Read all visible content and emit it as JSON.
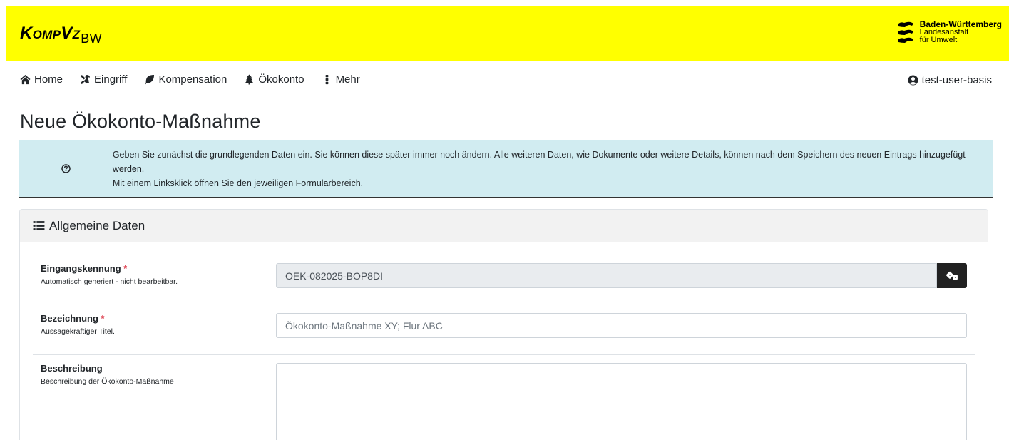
{
  "header": {
    "brand_main": "KOMPVZ",
    "brand_sub": "BW",
    "bw_line1": "Baden-Württemberg",
    "bw_line2": "Landesanstalt",
    "bw_line3": "für Umwelt"
  },
  "nav": {
    "items": [
      {
        "label": "Home",
        "icon": "home-icon"
      },
      {
        "label": "Eingriff",
        "icon": "tools-icon"
      },
      {
        "label": "Kompensation",
        "icon": "leaf-icon"
      },
      {
        "label": "Ökokonto",
        "icon": "tree-icon"
      },
      {
        "label": "Mehr",
        "icon": "vertical-dots-icon"
      }
    ],
    "user": "test-user-basis"
  },
  "page": {
    "title": "Neue Ökokonto-Maßnahme"
  },
  "info": {
    "line1": "Geben Sie zunächst die grundlegenden Daten ein. Sie können diese später immer noch ändern. Alle weiteren Daten, wie Dokumente oder weitere Details, können nach dem Speichern des neuen Eintrags hinzugefügt werden.",
    "line2": "Mit einem Linksklick öffnen Sie den jeweiligen Formularbereich."
  },
  "card": {
    "title": "Allgemeine Daten",
    "fields": {
      "identifier": {
        "label": "Eingangskennung",
        "required": "*",
        "help": "Automatisch generiert - nicht bearbeitbar.",
        "value": "OEK-082025-BOP8DI"
      },
      "title": {
        "label": "Bezeichnung",
        "required": "*",
        "help": "Aussagekräftiger Titel.",
        "placeholder": "Ökokonto-Maßnahme XY; Flur ABC"
      },
      "description": {
        "label": "Beschreibung",
        "help": "Beschreibung der Ökokonto-Maßnahme"
      }
    }
  },
  "colors": {
    "header_bg": "#ffff00",
    "info_bg": "#d1ecf1",
    "required": "#dc3545",
    "button_dark": "#212121"
  }
}
